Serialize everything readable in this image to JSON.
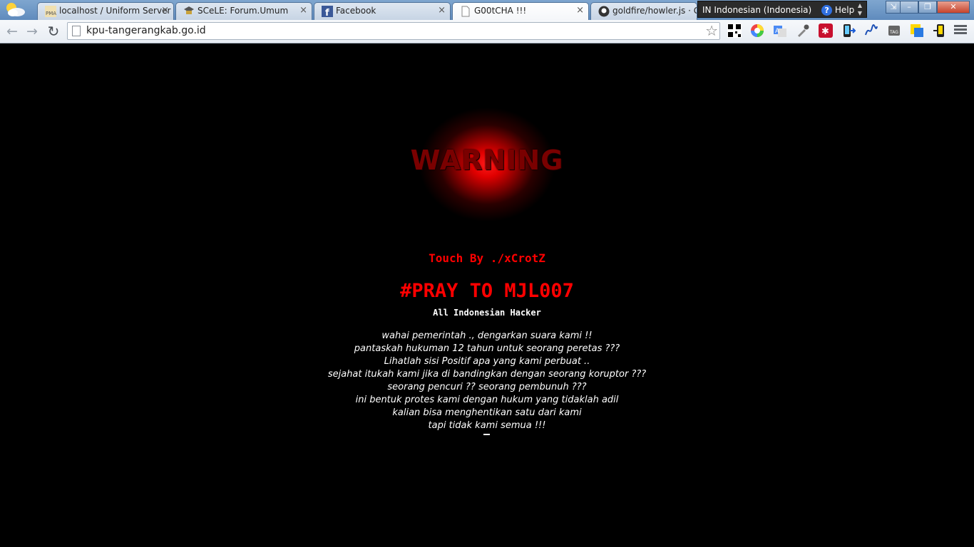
{
  "browser": {
    "tabs": [
      {
        "label": "localhost / Uniform Server",
        "favicon": "phpmyadmin-icon"
      },
      {
        "label": "SCeLE: Forum.Umum",
        "favicon": "scele-icon"
      },
      {
        "label": "Facebook",
        "favicon": "facebook-icon"
      },
      {
        "label": "G00tCHA !!!",
        "favicon": "blank-page-icon",
        "active": true
      },
      {
        "label": "goldfire/howler.js · GitHub",
        "favicon": "github-icon"
      }
    ],
    "notification": {
      "lang_code": "IN",
      "lang_label": "Indonesian (Indonesia)",
      "help": "Help"
    },
    "address": "kpu-tangerangkab.go.id",
    "extensions": [
      "qr-code-icon",
      "color-wheel-icon",
      "translate-icon",
      "eyedropper-icon",
      "lastpass-icon",
      "send-to-mobile-icon",
      "signature-icon",
      "tag-icon",
      "sticky-note-icon",
      "mobile-icon"
    ]
  },
  "page": {
    "logo_word": "WARNING",
    "touch_by": "Touch By ./xCrotZ",
    "headline": "#PRAY TO MJL007",
    "group": "All Indonesian Hacker",
    "message_lines": [
      "wahai pemerintah ., dengarkan suara kami !!",
      "pantaskah hukuman 12 tahun untuk seorang peretas ???",
      "Lihatlah sisi Positif apa yang kami perbuat ..",
      "sejahat itukah kami jika di bandingkan dengan seorang koruptor ???",
      "seorang pencuri ?? seorang pembunuh ???",
      "ini bentuk protes kami dengan hukum yang tidaklah adil",
      "kalian bisa menghentikan satu dari kami",
      "tapi tidak kami semua !!!"
    ]
  }
}
